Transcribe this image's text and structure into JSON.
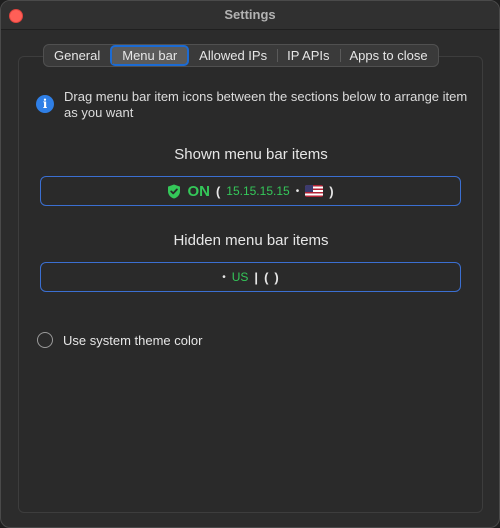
{
  "window": {
    "title": "Settings"
  },
  "tabs": [
    {
      "label": "General",
      "selected": false
    },
    {
      "label": "Menu bar",
      "selected": true
    },
    {
      "label": "Allowed IPs",
      "selected": false
    },
    {
      "label": "IP APIs",
      "selected": false
    },
    {
      "label": "Apps to close",
      "selected": false
    }
  ],
  "info": {
    "icon": "info-icon",
    "glyph": "i",
    "text": "Drag menu bar item icons between the sections below to arrange item as you want"
  },
  "shown_section": {
    "title": "Shown menu bar items",
    "status_icon": "shield-check-icon",
    "status": "ON",
    "open_paren": "(",
    "ip": "15.15.15.15",
    "separator": "•",
    "flag_icon": "us-flag-icon",
    "close_paren": ")"
  },
  "hidden_section": {
    "title": "Hidden menu bar items",
    "separator": "•",
    "country": "US",
    "pipe": "|",
    "open_paren": "(",
    "close_paren": ")"
  },
  "theme_option": {
    "label": "Use system theme color",
    "checked": false
  },
  "colors": {
    "accent": "#2f7fe6",
    "status_green": "#34c759",
    "focus_border": "#3b6fd1",
    "close_button": "#ff5f57"
  }
}
